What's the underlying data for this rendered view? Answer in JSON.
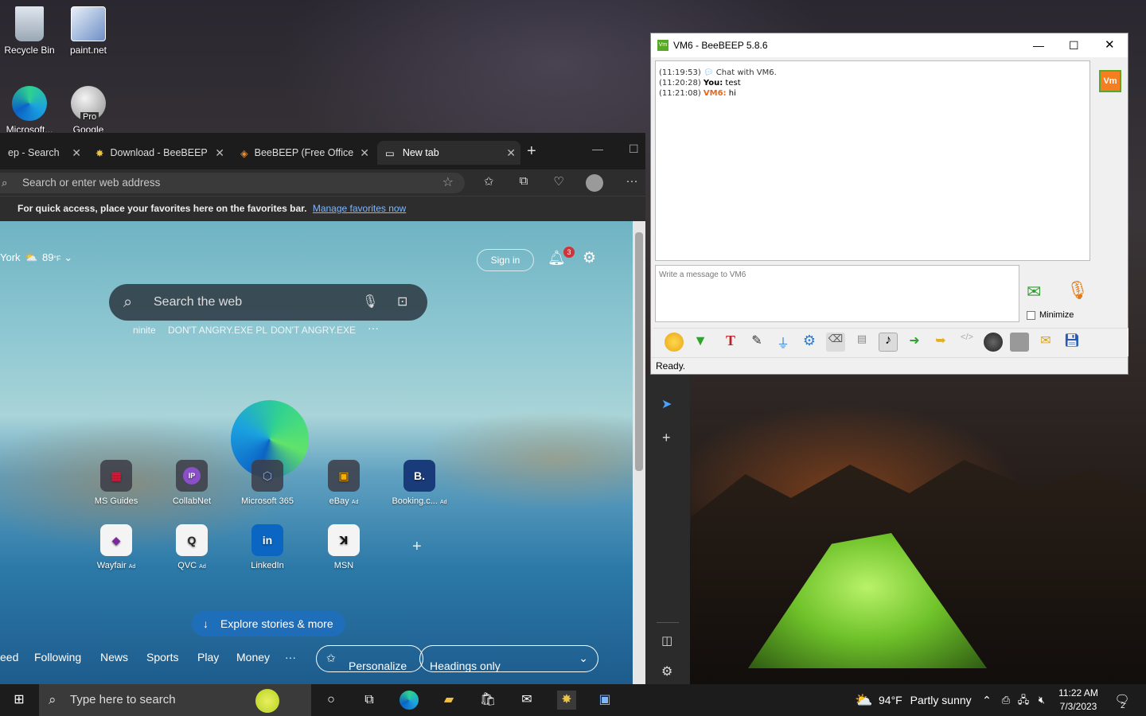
{
  "desktop": {
    "icons": [
      {
        "label": "Recycle Bin",
        "icon": "recycle-bin-icon"
      },
      {
        "label": "paint.net",
        "icon": "paintnet-icon"
      },
      {
        "label": "Microsoft...",
        "icon": "edge-icon"
      },
      {
        "label": "Google Earth",
        "icon": "google-earth-pro-icon",
        "badge": "Pro"
      }
    ]
  },
  "browser": {
    "tabs": [
      {
        "label": "ep - Search",
        "icon": "search-icon"
      },
      {
        "label": "Download - BeeBEEP",
        "icon": "bee-icon"
      },
      {
        "label": "BeeBEEP (Free Office",
        "icon": "diamond-icon"
      },
      {
        "label": "New tab",
        "icon": "newtab-icon"
      }
    ],
    "address_placeholder": "Search or enter web address",
    "favorites_bar": {
      "text": "For quick access, place your favorites here on the favorites bar.",
      "link": "Manage favorites now"
    },
    "new_tab_page": {
      "weather": {
        "location": "York",
        "temp": "89",
        "unit": "°F"
      },
      "sign_in": "Sign in",
      "notifications": "3",
      "search_placeholder": "Search the web",
      "recent_searches": [
        "ninite",
        "DON'T ANGRY.EXE PL",
        "DON'T ANGRY.EXE"
      ],
      "quick_links": [
        {
          "label": "MS Guides",
          "ad": ""
        },
        {
          "label": "CollabNet",
          "ad": ""
        },
        {
          "label": "Microsoft 365",
          "ad": ""
        },
        {
          "label": "eBay",
          "ad": "Ad"
        },
        {
          "label": "Booking.c...",
          "ad": "Ad"
        },
        {
          "label": "Wayfair",
          "ad": "Ad"
        },
        {
          "label": "QVC",
          "ad": "Ad"
        },
        {
          "label": "LinkedIn",
          "ad": ""
        },
        {
          "label": "MSN",
          "ad": ""
        }
      ],
      "explore": "Explore stories & more",
      "feed_tabs": [
        "eed",
        "Following",
        "News",
        "Sports",
        "Play",
        "Money",
        "···"
      ],
      "personalize": "Personalize",
      "headings": "Headings only"
    }
  },
  "beebeep": {
    "title": "VM6 - BeeBEEP 5.8.6",
    "avatar": "Vm",
    "messages": [
      {
        "time": "(11:19:53)",
        "sender": "",
        "text": "Chat with VM6."
      },
      {
        "time": "(11:20:28)",
        "sender": "You:",
        "text": "test"
      },
      {
        "time": "(11:21:08)",
        "sender": "VM6:",
        "text": "hi"
      }
    ],
    "input_placeholder": "Write a message to VM6",
    "minimize_label": "Minimize",
    "status": "Ready."
  },
  "taskbar": {
    "search_placeholder": "Type here to search",
    "weather": "94°F",
    "weather_desc": "Partly sunny",
    "time": "11:22 AM",
    "date": "7/3/2023",
    "notifications": "2"
  }
}
